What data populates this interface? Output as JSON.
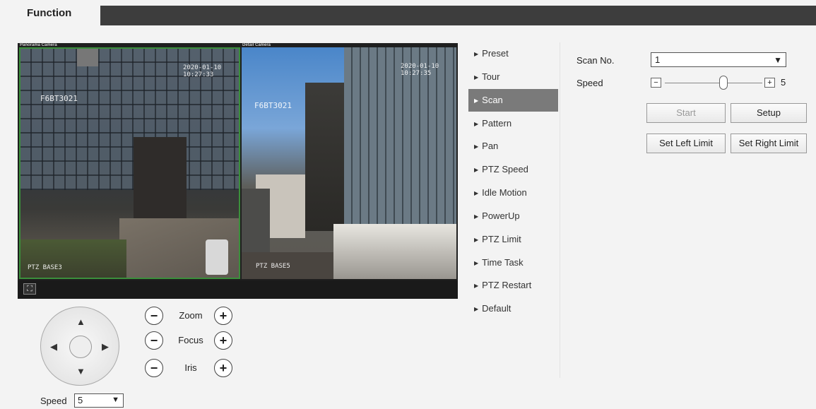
{
  "header": {
    "tab_label": "Function"
  },
  "video": {
    "left_camera_label": "Panorama Camera",
    "right_camera_label": "Detail Camera",
    "left_osd_time": "2020-01-10 10:27:33",
    "left_osd_name": "F6BT3021",
    "left_osd_bottom": "PTZ BASE3",
    "right_osd_time": "2020-01-10 10:27:35",
    "right_osd_name": "F6BT3021",
    "right_osd_bottom": "PTZ BASE5",
    "fullscreen_icon": "fullscreen-icon"
  },
  "ptz": {
    "zoom_label": "Zoom",
    "focus_label": "Focus",
    "iris_label": "Iris",
    "minus_symbol": "−",
    "plus_symbol": "+",
    "speed_label": "Speed",
    "speed_value": "5"
  },
  "menu": {
    "items": [
      {
        "label": "Preset"
      },
      {
        "label": "Tour"
      },
      {
        "label": "Scan"
      },
      {
        "label": "Pattern"
      },
      {
        "label": "Pan"
      },
      {
        "label": "PTZ Speed"
      },
      {
        "label": "Idle Motion"
      },
      {
        "label": "PowerUp"
      },
      {
        "label": "PTZ Limit"
      },
      {
        "label": "Time Task"
      },
      {
        "label": "PTZ Restart"
      },
      {
        "label": "Default"
      }
    ],
    "active": "Scan"
  },
  "scan": {
    "scan_no_label": "Scan No.",
    "scan_no_value": "1",
    "speed_label": "Speed",
    "speed_value": "5",
    "speed_fraction": 0.6,
    "start_label": "Start",
    "setup_label": "Setup",
    "set_left_label": "Set Left Limit",
    "set_right_label": "Set Right Limit"
  },
  "colors": {
    "active_menu_bg": "#7a7a7a",
    "selected_camera_border": "#3b8f3b",
    "header_bar": "#3d3d3d"
  }
}
